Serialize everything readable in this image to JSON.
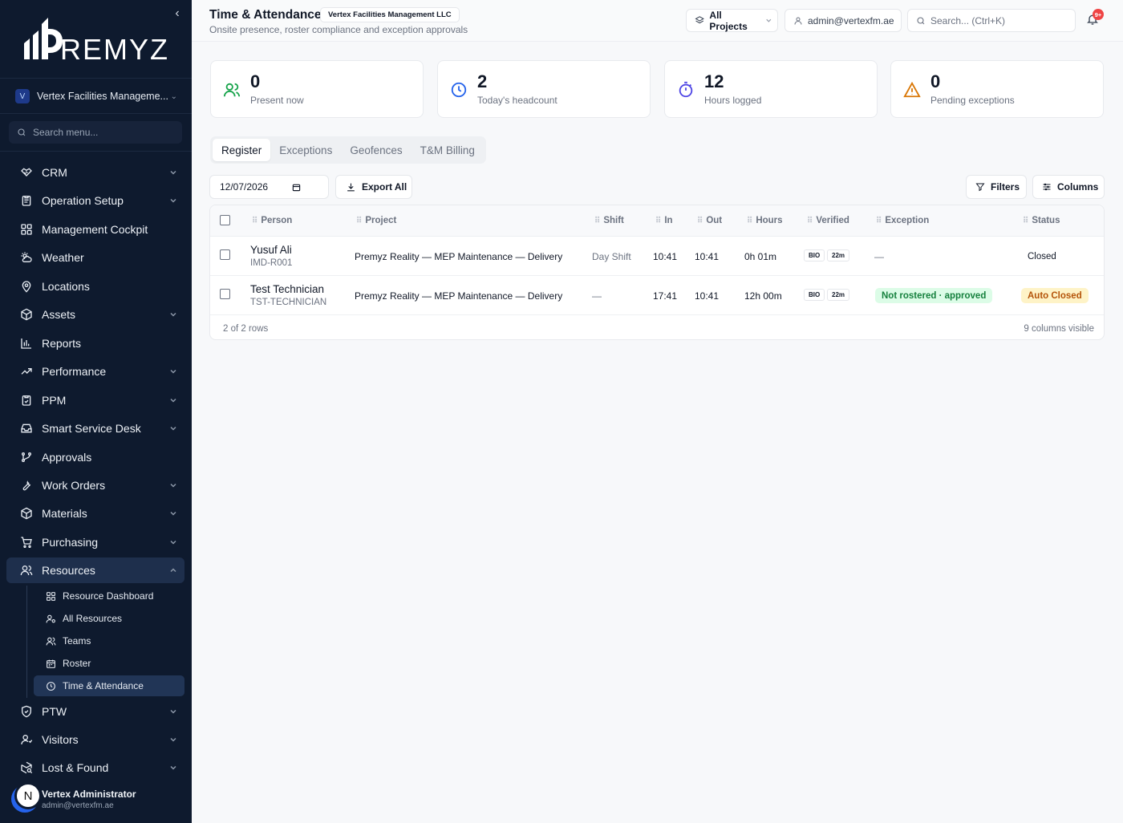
{
  "sidebar": {
    "brand": "REMYZ",
    "org_badge": "V",
    "org_name": "Vertex Facilities Manageme...",
    "search_placeholder": "Search menu...",
    "items": [
      {
        "label": "CRM"
      },
      {
        "label": "Operation Setup"
      },
      {
        "label": "Management Cockpit"
      },
      {
        "label": "Weather"
      },
      {
        "label": "Locations"
      },
      {
        "label": "Assets"
      },
      {
        "label": "Reports"
      },
      {
        "label": "Performance"
      },
      {
        "label": "PPM"
      },
      {
        "label": "Smart Service Desk"
      },
      {
        "label": "Approvals"
      },
      {
        "label": "Work Orders"
      },
      {
        "label": "Materials"
      },
      {
        "label": "Purchasing"
      },
      {
        "label": "Resources"
      },
      {
        "label": "PTW"
      },
      {
        "label": "Visitors"
      },
      {
        "label": "Lost & Found"
      }
    ],
    "resources_sub": [
      {
        "label": "Resource Dashboard"
      },
      {
        "label": "All Resources"
      },
      {
        "label": "Teams"
      },
      {
        "label": "Roster"
      },
      {
        "label": "Time & Attendance"
      }
    ],
    "user": {
      "initial": "N",
      "name": "Vertex Administrator",
      "email": "admin@vertexfm.ae"
    }
  },
  "header": {
    "title": "Time & Attendance",
    "org_tag": "Vertex Facilities Management LLC",
    "subtitle": "Onsite presence, roster compliance and exception approvals",
    "projects": "All Projects",
    "user_email": "admin@vertexfm.ae",
    "search_placeholder": "Search... (Ctrl+K)",
    "notifications": "9+"
  },
  "stats": [
    {
      "value": "0",
      "label": "Present now",
      "color": "#16a34a"
    },
    {
      "value": "2",
      "label": "Today's headcount",
      "color": "#2563eb"
    },
    {
      "value": "12",
      "label": "Hours logged",
      "color": "#4f46e5"
    },
    {
      "value": "0",
      "label": "Pending exceptions",
      "color": "#d97706"
    }
  ],
  "tabs": [
    "Register",
    "Exceptions",
    "Geofences",
    "T&M Billing"
  ],
  "toolbar": {
    "date": "12/07/2026",
    "export": "Export All",
    "filters": "Filters",
    "columns": "Columns"
  },
  "table": {
    "headers": [
      "Person",
      "Project",
      "Shift",
      "In",
      "Out",
      "Hours",
      "Verified",
      "Exception",
      "Status"
    ],
    "rows": [
      {
        "name": "Yusuf Ali",
        "id": "IMD-R001",
        "project": "Premyz Reality — MEP Maintenance — Delivery",
        "shift": "Day Shift",
        "in": "10:41",
        "out": "10:41",
        "hours": "0h 01m",
        "verified": "BIO",
        "verified_dur": "22m",
        "exception": "—",
        "status": "Closed"
      },
      {
        "name": "Test Technician",
        "id": "TST-TECHNICIAN",
        "project": "Premyz Reality — MEP Maintenance — Delivery",
        "shift": "—",
        "in": "17:41",
        "out": "10:41",
        "hours": "12h 00m",
        "verified": "BIO",
        "verified_dur": "22m",
        "exception": "Not rostered · approved",
        "status": "Auto Closed"
      }
    ],
    "footer_left": "2 of 2 rows",
    "footer_right": "9 columns visible"
  },
  "colors": {
    "sidebar": "#0e1a2e",
    "success_bg": "#dcfce7",
    "success_fg": "#15803d",
    "warn_bg": "#fef3c7",
    "warn_fg": "#b45309"
  }
}
